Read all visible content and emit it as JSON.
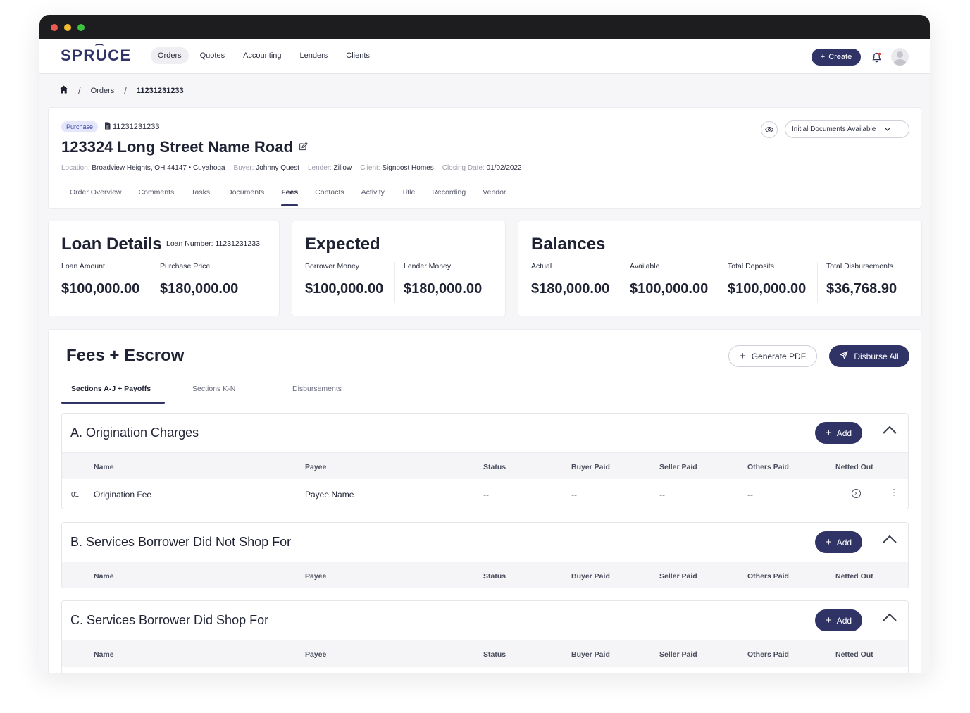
{
  "window": {
    "dots": [
      "#ee5a52",
      "#f4bc2f",
      "#3ec242"
    ]
  },
  "nav": {
    "logo": "SPRUCE",
    "items": [
      "Orders",
      "Quotes",
      "Accounting",
      "Lenders",
      "Clients"
    ],
    "create_label": "Create"
  },
  "breadcrumb": {
    "orders": "Orders",
    "order_id": "11231231233"
  },
  "order": {
    "badge": "Purchase",
    "number": "11231231233",
    "address": "123324 Long Street Name Road",
    "location_label": "Location:",
    "location": "Broadview Heights, OH 44147 • Cuyahoga",
    "buyer_label": "Buyer:",
    "buyer": "Johnny Quest",
    "lender_label": "Lender:",
    "lender": "Zillow",
    "client_label": "Client:",
    "client": "Signpost Homes",
    "closing_label": "Closing Date:",
    "closing": "01/02/2022",
    "status": "Initial Documents Available",
    "tabs": [
      "Order Overview",
      "Comments",
      "Tasks",
      "Documents",
      "Fees",
      "Contacts",
      "Activity",
      "Title",
      "Recording",
      "Vendor"
    ]
  },
  "loan": {
    "title": "Loan Details",
    "loan_number": "Loan Number: 11231231233",
    "amount_label": "Loan Amount",
    "amount": "$100,000.00",
    "price_label": "Purchase Price",
    "price": "$180,000.00"
  },
  "expected": {
    "title": "Expected",
    "borrower_label": "Borrower Money",
    "borrower": "$100,000.00",
    "lender_label": "Lender Money",
    "lender": "$180,000.00"
  },
  "balances": {
    "title": "Balances",
    "actual_label": "Actual",
    "actual": "$180,000.00",
    "available_label": "Available",
    "available": "$100,000.00",
    "deposits_label": "Total Deposits",
    "deposits": "$100,000.00",
    "disb_label": "Total Disbursements",
    "disb": "$36,768.90"
  },
  "fees": {
    "title": "Fees + Escrow",
    "gen_pdf": "Generate PDF",
    "disburse": "Disburse All",
    "tabs": [
      "Sections A-J + Payoffs",
      "Sections K-N",
      "Disbursements"
    ],
    "add_label": "Add",
    "columns": [
      "Name",
      "Payee",
      "Status",
      "Buyer Paid",
      "Seller Paid",
      "Others Paid",
      "Netted Out"
    ],
    "sections": [
      {
        "title": "A. Origination Charges",
        "rows": [
          {
            "num": "01",
            "name": "Origination Fee",
            "payee": "Payee Name",
            "status": "--",
            "buyer": "--",
            "seller": "--",
            "others": "--"
          }
        ]
      },
      {
        "title": "B. Services Borrower Did Not Shop For",
        "rows": []
      },
      {
        "title": "C. Services Borrower Did Shop For",
        "rows": []
      }
    ]
  }
}
